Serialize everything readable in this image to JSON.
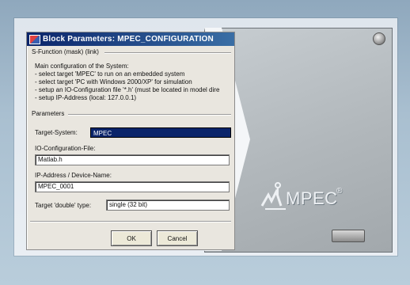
{
  "dialog": {
    "title": "Block Parameters:  MPEC_CONFIGURATION",
    "section_header": "S-Function (mask) (link)",
    "description": [
      "Main configuration of the System:",
      "- select target 'MPEC' to run on an embedded system",
      "- select target 'PC with Windows 2000/XP' for simulation",
      "- setup an IO-Configuration file '*.h' (must be located in model dire",
      "- setup IP-Address (local: 127.0.0.1)"
    ],
    "parameters_header": "Parameters",
    "target_system_label": "Target-System:",
    "target_system_value": "MPEC",
    "io_config_label": "IO-Configuration-File:",
    "io_config_value": "Matlab.h",
    "ip_label": "IP-Address / Device-Name:",
    "ip_value": "MPEC_0001",
    "double_type_label": "Target 'double' type:",
    "double_type_value": "single (32 bit)",
    "ok_label": "OK",
    "cancel_label": "Cancel"
  },
  "device": {
    "brand": "MPEC",
    "brand_suffix": "®"
  },
  "colors": {
    "titlebar": "#0a246a",
    "panel": "#b1b7bb",
    "background": "#a9bfd0"
  }
}
